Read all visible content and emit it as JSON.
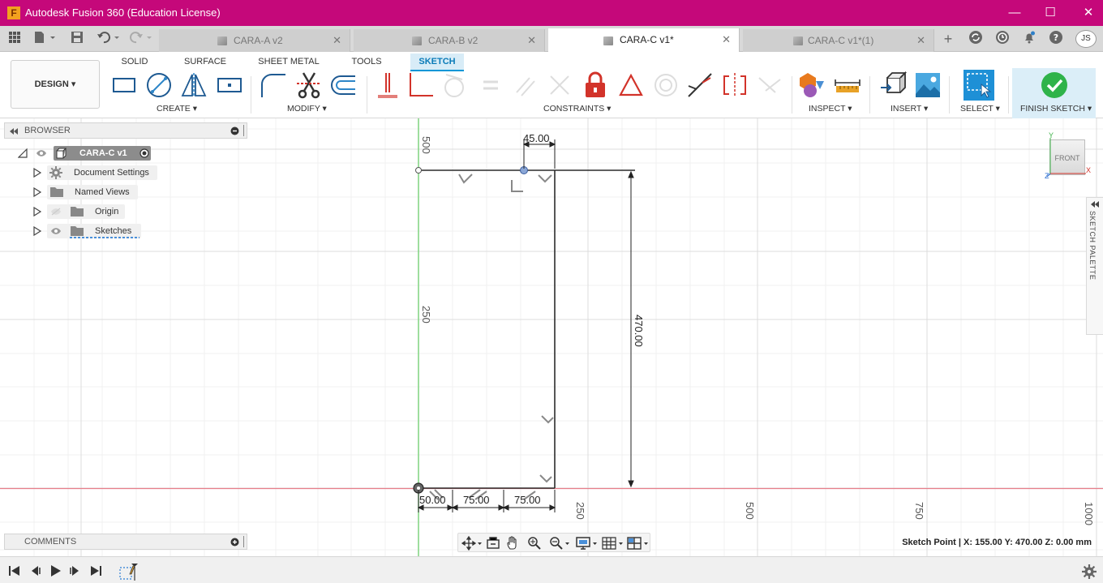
{
  "window": {
    "title": "Autodesk Fusion 360 (Education License)",
    "app_icon_letter": "F",
    "minimize": "—",
    "maximize": "☐",
    "close": "✕",
    "accent": "#c5087a"
  },
  "tabs": [
    {
      "label": "CARA-A v2",
      "active": false
    },
    {
      "label": "CARA-B v2",
      "active": false
    },
    {
      "label": "CARA-C v1*",
      "active": true
    },
    {
      "label": "CARA-C v1*(1)",
      "active": false
    }
  ],
  "tab_close": "✕",
  "user_initials": "JS",
  "ribbon": {
    "workspace": "DESIGN ▾",
    "tabs": [
      "SOLID",
      "SURFACE",
      "SHEET METAL",
      "TOOLS",
      "SKETCH"
    ],
    "active_tab": "SKETCH",
    "groups": {
      "create": "CREATE ▾",
      "modify": "MODIFY ▾",
      "constraints": "CONSTRAINTS ▾",
      "inspect": "INSPECT ▾",
      "insert": "INSERT ▾",
      "select": "SELECT ▾",
      "finish": "FINISH SKETCH ▾"
    }
  },
  "browser": {
    "title": "BROWSER",
    "root": "CARA-C v1",
    "items": [
      "Document Settings",
      "Named Views",
      "Origin",
      "Sketches"
    ]
  },
  "comments": {
    "title": "COMMENTS"
  },
  "canvas": {
    "axis_labels": {
      "v500": "500",
      "v250": "250",
      "h250": "250",
      "h500": "500",
      "h750": "750",
      "h1000": "1000"
    },
    "dimensions": {
      "top": "45.00",
      "height": "470.00",
      "b1": "50.00",
      "b2": "75.00",
      "b3": "75.00"
    }
  },
  "viewcube": {
    "face": "FRONT",
    "axis_x": "X",
    "axis_y": "Y",
    "axis_z": "Z"
  },
  "palette": {
    "label": "SKETCH PALETTE"
  },
  "status": "Sketch Point | X: 155.00 Y: 470.00 Z: 0.00 mm"
}
